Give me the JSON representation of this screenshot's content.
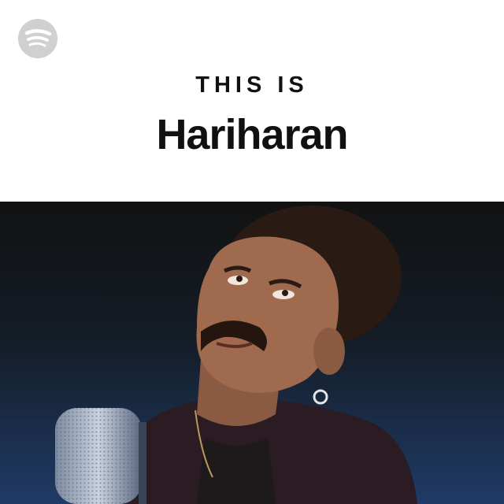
{
  "cover": {
    "brand_icon": "spotify-icon",
    "label": "THIS IS",
    "artist": "Hariharan",
    "photo_icon": "artist-photo"
  },
  "colors": {
    "background_top": "#ffffff",
    "text": "#111111",
    "logo_gray": "#d0d0d0",
    "photo_dark": "#141414",
    "photo_blue": "#1e3a64"
  }
}
